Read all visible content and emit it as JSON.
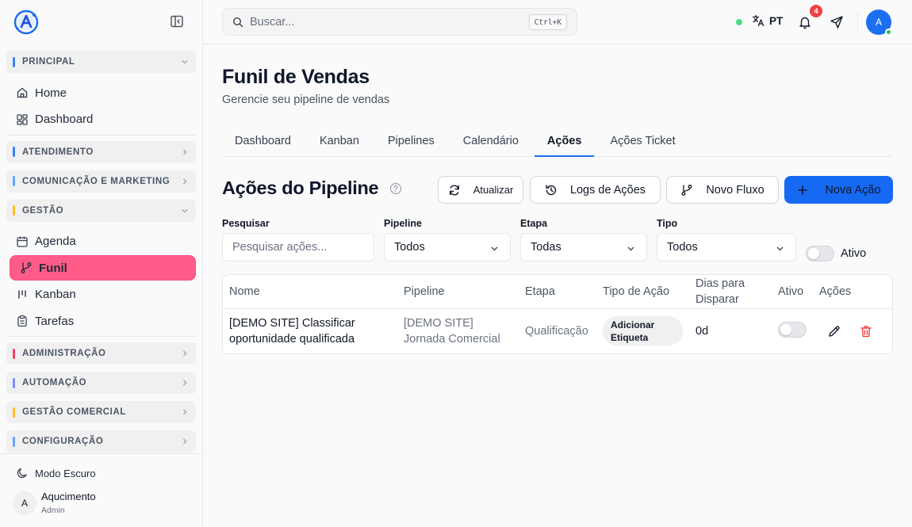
{
  "sidebar": {
    "sections": {
      "principal": "PRINCIPAL",
      "atendimento": "ATENDIMENTO",
      "comunicacao": "COMUNICAÇÃO E MARKETING",
      "gestao": "GESTÃO",
      "administracao": "ADMINISTRAÇÃO",
      "automacao": "AUTOMAÇÃO",
      "gestao_comercial": "GESTÃO COMERCIAL",
      "configuracao": "CONFIGURAÇÃO"
    },
    "section_colors": {
      "principal": "#3b82f6",
      "atendimento": "#3b82f6",
      "comunicacao": "#60a5fa",
      "gestao": "#fbbf24",
      "administracao": "#f43f5e",
      "automacao": "#818cf8",
      "gestao_comercial": "#fbbf24",
      "configuracao": "#60a5fa"
    },
    "items": {
      "home": "Home",
      "dashboard": "Dashboard",
      "agenda": "Agenda",
      "funil": "Funil",
      "kanban": "Kanban",
      "tarefas": "Tarefas"
    },
    "footer": {
      "dark_mode": "Modo Escuro",
      "user_initial": "A",
      "user_name": "Aqucimento",
      "user_role": "Admin"
    }
  },
  "topbar": {
    "search_placeholder": "Buscar...",
    "shortcut": "Ctrl+K",
    "language": "PT",
    "notification_count": "4",
    "avatar_initial": "A"
  },
  "page": {
    "title": "Funil de Vendas",
    "subtitle": "Gerencie seu pipeline de vendas",
    "tabs": [
      "Dashboard",
      "Kanban",
      "Pipelines",
      "Calendário",
      "Ações",
      "Ações Ticket"
    ],
    "active_tab": "Ações"
  },
  "actions_section": {
    "title": "Ações do Pipeline",
    "buttons": {
      "refresh": "Atualizar",
      "logs": "Logs de Ações",
      "new_flow": "Novo Fluxo",
      "new_action": "Nova Ação"
    },
    "filters": {
      "search_label": "Pesquisar",
      "search_placeholder": "Pesquisar ações...",
      "pipeline_label": "Pipeline",
      "pipeline_value": "Todos",
      "stage_label": "Etapa",
      "stage_value": "Todas",
      "type_label": "Tipo",
      "type_value": "Todos",
      "active_label": "Ativo",
      "active_on": false
    }
  },
  "table": {
    "headers": {
      "name": "Nome",
      "pipeline": "Pipeline",
      "stage": "Etapa",
      "action_type": "Tipo de Ação",
      "days_line1": "Dias para",
      "days_line2": "Disparar",
      "active": "Ativo",
      "actions": "Ações"
    },
    "rows": [
      {
        "name_line1": "[DEMO SITE] Classificar",
        "name_line2": "oportunidade qualificada",
        "pipeline_line1": "[DEMO SITE]",
        "pipeline_line2": "Jornada Comercial",
        "stage": "Qualificação",
        "type_line1": "Adicionar",
        "type_line2": "Etiqueta",
        "days": "0d",
        "active": false
      }
    ]
  },
  "colors": {
    "primary": "#1669f2",
    "active_nav": "#ff5c8a",
    "danger": "#ef4444",
    "online": "#22c55e"
  }
}
